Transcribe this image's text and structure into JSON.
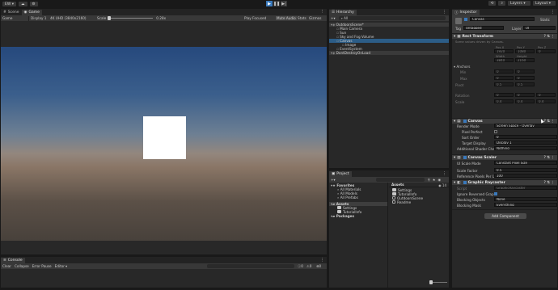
{
  "topbar": {
    "account": "EW",
    "cloud_icon": "cloud-icon",
    "collab_icon": "collab-icon",
    "play_icon": "play-icon",
    "pause_icon": "pause-icon",
    "step_icon": "step-icon",
    "history_icon": "history-icon",
    "search_icon": "search-icon",
    "layers": "Layers",
    "layout": "Layout"
  },
  "scene": {
    "tabs": [
      "Scene",
      "Game"
    ],
    "toolbar": {
      "mode": "Game",
      "display": "Display 1",
      "resolution": "4K UHD (3840x2160)",
      "scale_label": "Scale",
      "scale_value": "0.28x",
      "play_focused": "Play Focused",
      "mute_audio": "Mute Audio",
      "stats": "Stats",
      "gizmos": "Gizmos"
    },
    "sky_top": "#2f4f7a",
    "horizon": "#8a7a72",
    "ground": "#3a3735"
  },
  "hierarchy": {
    "tab": "Hierarchy",
    "search": "All",
    "items": [
      {
        "label": "OutdoorsScene*",
        "level": 0,
        "scene": true
      },
      {
        "label": "Main Camera",
        "level": 1
      },
      {
        "label": "Sun",
        "level": 1
      },
      {
        "label": "Sky and Fog Volume",
        "level": 1
      },
      {
        "label": "Canvas",
        "level": 1,
        "selected": true
      },
      {
        "label": "Image",
        "level": 2
      },
      {
        "label": "EventSystem",
        "level": 1
      },
      {
        "label": "DontDestroyOnLoad",
        "level": 0,
        "scene": true
      }
    ]
  },
  "project": {
    "tab": "Project",
    "tree": [
      {
        "label": "Favorites",
        "level": 0,
        "bold": true
      },
      {
        "label": "All Materials",
        "level": 1
      },
      {
        "label": "All Models",
        "level": 1
      },
      {
        "label": "All Prefabs",
        "level": 1
      },
      {
        "label": "Assets",
        "level": 0,
        "bold": true,
        "selected": true
      },
      {
        "label": "Settings",
        "level": 1
      },
      {
        "label": "TutorialInfo",
        "level": 1
      },
      {
        "label": "Packages",
        "level": 0,
        "bold": true
      }
    ],
    "breadcrumb": "Assets",
    "assets": [
      "Settings",
      "TutorialInfo",
      "OutdoorsScene",
      "Readme"
    ],
    "count": "14"
  },
  "console": {
    "tab": "Console",
    "buttons": [
      "Clear",
      "Collapse",
      "Error Pause",
      "Editor"
    ],
    "counts": [
      "0",
      "0",
      "0"
    ]
  },
  "inspector": {
    "tab": "Inspector",
    "name": "Canvas",
    "static": "Static",
    "tag_label": "Tag",
    "tag_value": "Untagged",
    "layer_label": "Layer",
    "layer_value": "UI",
    "rect_transform": {
      "title": "Rect Transform",
      "note": "Some values driven by Canvas.",
      "pos_headers": [
        "Pos X",
        "Pos Y",
        "Pos Z"
      ],
      "pos_values": [
        "1920",
        "1080",
        "0"
      ],
      "size_headers": [
        "Width",
        "Height"
      ],
      "size_values": [
        "3840",
        "2160"
      ],
      "anchors": "Anchors",
      "min_label": "Min",
      "min_values": [
        "0",
        "0"
      ],
      "max_label": "Max",
      "max_values": [
        "0",
        "0"
      ],
      "pivot_label": "Pivot",
      "pivot_values": [
        "0.5",
        "0.5"
      ],
      "rotation_label": "Rotation",
      "rotation_values": [
        "0",
        "0",
        "0"
      ],
      "scale_label": "Scale",
      "scale_values": [
        "0.4",
        "0.4",
        "0.4"
      ]
    },
    "canvas": {
      "title": "Canvas",
      "render_mode_label": "Render Mode",
      "render_mode": "Screen Space - Overlay",
      "pixel_perfect": "Pixel Perfect",
      "sort_order_label": "Sort Order",
      "sort_order": "0",
      "target_display_label": "Target Display",
      "target_display": "Display 1",
      "shader_channels_label": "Additional Shader Cha",
      "shader_channels": "Nothing"
    },
    "canvas_scaler": {
      "title": "Canvas Scaler",
      "ui_scale_mode_label": "UI Scale Mode",
      "ui_scale_mode": "Constant Pixel Size",
      "scale_factor_label": "Scale Factor",
      "scale_factor": "0.5",
      "ref_ppu_label": "Reference Pixels Per U",
      "ref_ppu": "100"
    },
    "graphic_raycaster": {
      "title": "Graphic Raycaster",
      "script_label": "Script",
      "script_value": "GraphicRaycaster",
      "ignore_reversed_label": "Ignore Reversed Graph",
      "blocking_objects_label": "Blocking Objects",
      "blocking_objects": "None",
      "blocking_mask_label": "Blocking Mask",
      "blocking_mask": "Everything"
    },
    "add_component": "Add Component"
  }
}
